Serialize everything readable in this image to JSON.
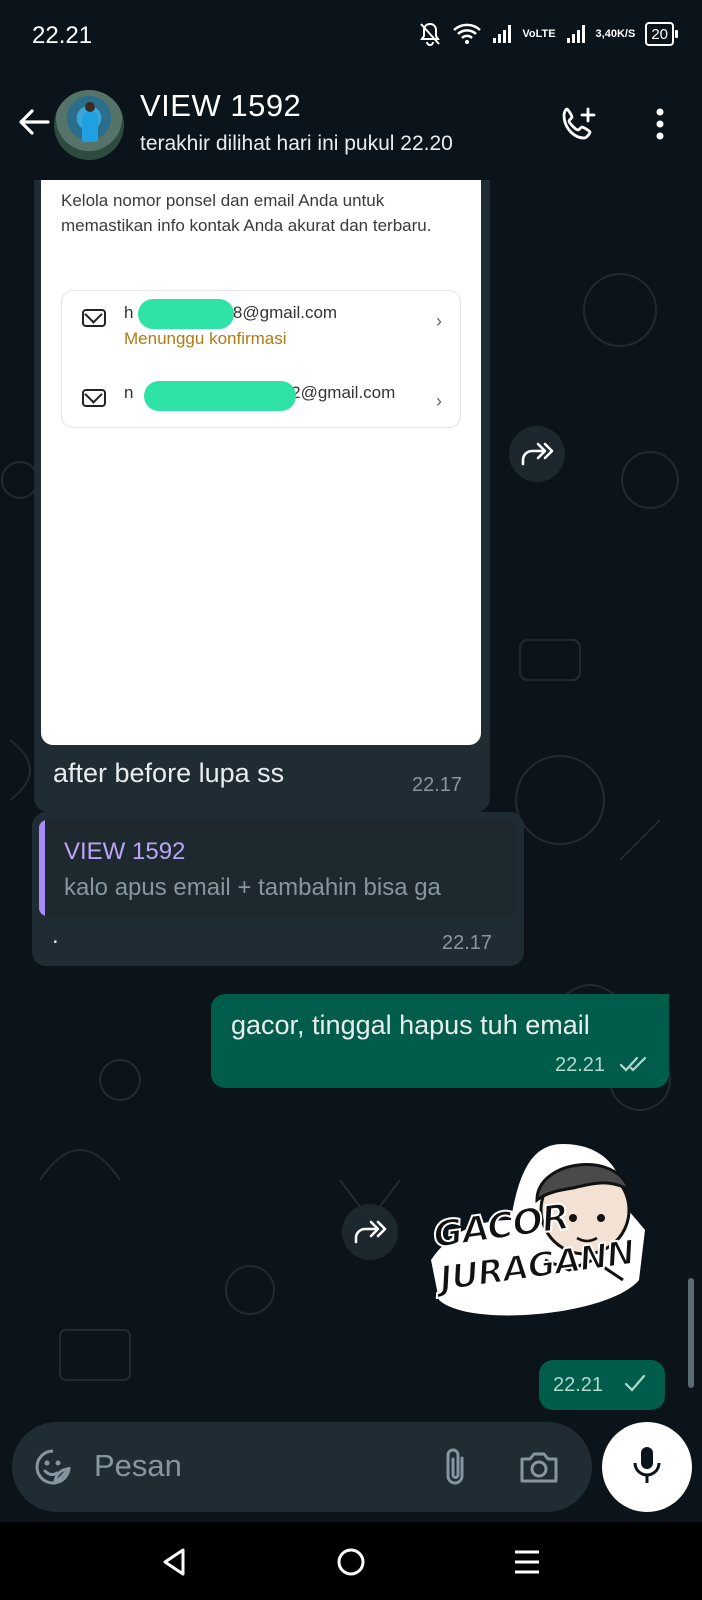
{
  "status_bar": {
    "time": "22.21",
    "net_speed_value": "3,40",
    "net_speed_unit": "K/S",
    "volte_top": "Vo",
    "volte_bottom": "LTE",
    "battery": "20",
    "icons": [
      "mute-bell-icon",
      "wifi-icon",
      "signal-icon",
      "signal-icon",
      "battery-icon"
    ]
  },
  "header": {
    "contact_name": "VIEW 1592",
    "last_seen": "terakhir dilihat hari ini pukul 22.20",
    "icons": [
      "back-arrow-icon",
      "add-call-icon",
      "more-vert-icon"
    ]
  },
  "messages": {
    "image_message": {
      "screenshot": {
        "description": "Kelola nomor ponsel dan email Anda untuk memastikan info kontak Anda akurat dan terbaru.",
        "email_1_prefix": "h",
        "email_1_suffix": "08@gmail.com",
        "email_1_status": "Menunggu konfirmasi",
        "email_2_prefix": "n",
        "email_2_suffix": "112@gmail.com"
      },
      "caption": "after before lupa ss",
      "time": "22.17"
    },
    "reply_message": {
      "quoted_name": "VIEW 1592",
      "quoted_text": "kalo apus email + tambahin bisa ga",
      "text": ".",
      "time": "22.17"
    },
    "outgoing_message": {
      "text": "gacor, tinggal hapus tuh email",
      "time": "22.21",
      "status": "read"
    },
    "sticker_message": {
      "sticker_line_1": "GACOR",
      "sticker_line_2": "JURAGANN",
      "time": "22.21",
      "status": "sent"
    }
  },
  "composer": {
    "placeholder": "Pesan",
    "icons": [
      "sticker-emoji-icon",
      "attach-icon",
      "camera-icon",
      "mic-icon"
    ]
  },
  "colors": {
    "background": "#0b141a",
    "incoming_bubble": "#202c33",
    "outgoing_bubble": "#005c4b",
    "accent": "#00a884"
  }
}
